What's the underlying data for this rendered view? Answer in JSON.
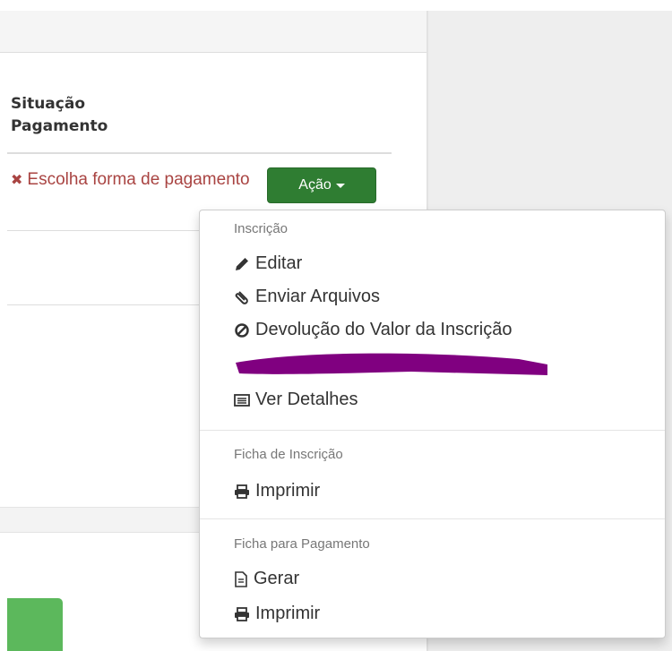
{
  "table": {
    "column_header": "Situação\nPagamento",
    "payment_status": "Escolha forma de pagamento",
    "status_icon": "times-icon",
    "action_button_label": "Ação"
  },
  "dropdown": {
    "sections": [
      {
        "header": "Inscrição",
        "items": [
          {
            "label": "Editar",
            "icon": "pencil-icon"
          },
          {
            "label": "Enviar Arquivos",
            "icon": "paperclip-icon"
          },
          {
            "label": "Devolução do Valor da Inscrição",
            "icon": "ban-icon"
          },
          {
            "label": "Ver Detalhes",
            "icon": "list-alt-icon"
          }
        ]
      },
      {
        "header": "Ficha de Inscrição",
        "items": [
          {
            "label": "Imprimir",
            "icon": "print-icon"
          }
        ]
      },
      {
        "header": "Ficha para Pagamento",
        "items": [
          {
            "label": "Gerar",
            "icon": "file-icon"
          },
          {
            "label": "Imprimir",
            "icon": "print-icon"
          }
        ]
      }
    ]
  },
  "colors": {
    "action_button": "#2f7d32",
    "status_text": "#a94442",
    "redaction_mark": "#800080",
    "green_block": "#5cb85c"
  }
}
